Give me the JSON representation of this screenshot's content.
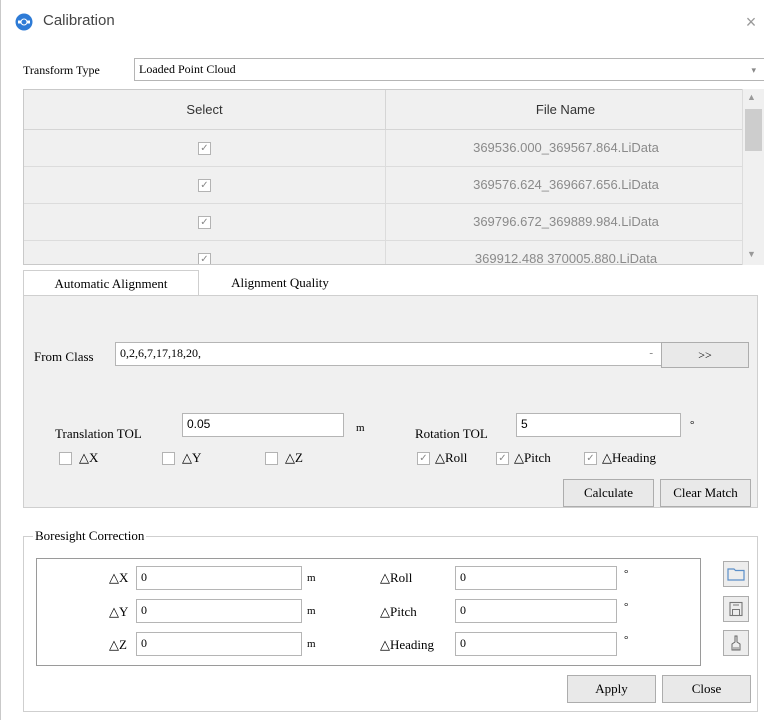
{
  "window": {
    "title": "Calibration",
    "close_glyph": "×"
  },
  "transform_type": {
    "label": "Transform Type",
    "value": "Loaded Point Cloud"
  },
  "table": {
    "headers": [
      "Select",
      "File Name"
    ],
    "rows": [
      {
        "checked": true,
        "file": "369536.000_369567.864.LiData"
      },
      {
        "checked": true,
        "file": "369576.624_369667.656.LiData"
      },
      {
        "checked": true,
        "file": "369796.672_369889.984.LiData"
      },
      {
        "checked": true,
        "file": "369912.488 370005.880.LiData"
      }
    ]
  },
  "tabs": [
    "Automatic Alignment",
    "Alignment Quality"
  ],
  "alignment": {
    "from_class_label": "From Class",
    "from_class_value": "0,2,6,7,17,18,20,",
    "expand_button": ">>",
    "translation_tol_label": "Translation TOL",
    "translation_tol_value": "0.05",
    "translation_unit": "m",
    "rotation_tol_label": "Rotation TOL",
    "rotation_tol_value": "5",
    "rotation_unit": "°",
    "checks": {
      "dx": {
        "label": "△X",
        "checked": false
      },
      "dy": {
        "label": "△Y",
        "checked": false
      },
      "dz": {
        "label": "△Z",
        "checked": false
      },
      "droll": {
        "label": "△Roll",
        "checked": true
      },
      "dpitch": {
        "label": "△Pitch",
        "checked": true
      },
      "dheading": {
        "label": "△Heading",
        "checked": true
      }
    },
    "calculate_button": "Calculate",
    "clear_match_button": "Clear Match"
  },
  "boresight": {
    "title": "Boresight Correction",
    "dx_label": "△X",
    "dx_value": "0",
    "dx_unit": "m",
    "dy_label": "△Y",
    "dy_value": "0",
    "dy_unit": "m",
    "dz_label": "△Z",
    "dz_value": "0",
    "dz_unit": "m",
    "droll_label": "△Roll",
    "droll_value": "0",
    "droll_unit": "°",
    "dpitch_label": "△Pitch",
    "dpitch_value": "0",
    "dpitch_unit": "°",
    "dheading_label": "△Heading",
    "dheading_value": "0",
    "dheading_unit": "°",
    "icons": [
      "folder-icon",
      "save-icon",
      "brush-icon"
    ]
  },
  "footer": {
    "apply_button": "Apply",
    "close_button": "Close"
  },
  "colors": {
    "panel_bg": "#f0f0f0",
    "border": "#cfcfcf",
    "app_icon": "#2e7bd6"
  }
}
